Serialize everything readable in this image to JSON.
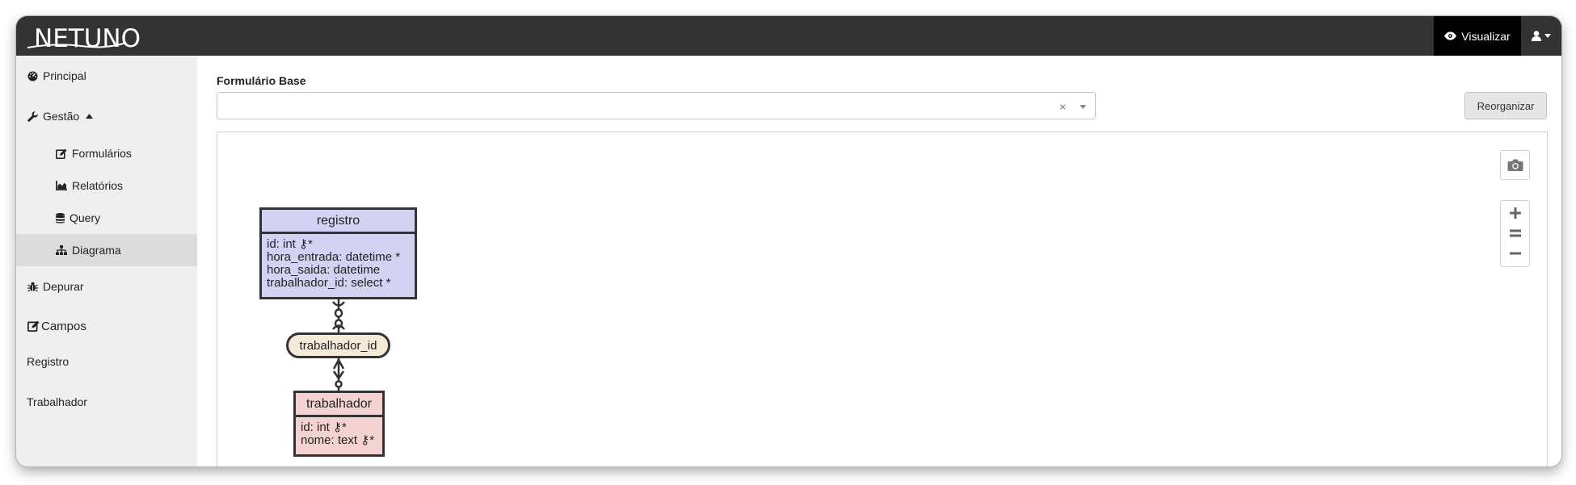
{
  "app": {
    "logo_text": "NETUNO",
    "visualizar_label": "Visualizar"
  },
  "sidebar": {
    "items": [
      {
        "label": "Principal",
        "icon": "dashboard-icon"
      },
      {
        "label": "Gestão",
        "icon": "wrench-icon",
        "expanded": true
      },
      {
        "label": "Formulários",
        "icon": "edit-icon"
      },
      {
        "label": "Relatórios",
        "icon": "area-chart-icon"
      },
      {
        "label": "Query",
        "icon": "database-icon"
      },
      {
        "label": "Diagrama",
        "icon": "sitemap-icon",
        "active": true
      },
      {
        "label": "Depurar",
        "icon": "bug-icon"
      },
      {
        "label": "Campos",
        "icon": "edit-icon"
      },
      {
        "label": "Registro"
      },
      {
        "label": "Trabalhador"
      }
    ]
  },
  "main": {
    "base_form_label": "Formulário Base",
    "base_form_value": "",
    "reorganize_label": "Reorganizar"
  },
  "diagram": {
    "entities": [
      {
        "name": "registro",
        "fields": "id: int ⚷*\nhora_entrada: datetime *\nhora_saida: datetime\ntrabalhador_id: select *",
        "color": "#d4d2f2"
      },
      {
        "name": "trabalhador",
        "fields": "id: int ⚷*\nnome: text ⚷*",
        "color": "#f4d2d2"
      }
    ],
    "relationship": {
      "name": "trabalhador_id",
      "color": "#f3ead8"
    }
  },
  "colors": {
    "navbar": "#333333",
    "sidebar": "#efefef",
    "active_item": "#dcdcdc"
  }
}
